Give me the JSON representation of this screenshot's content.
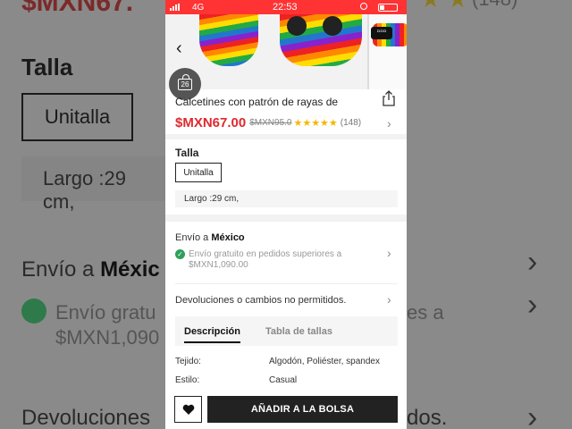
{
  "status_bar": {
    "network": "4G",
    "time": "22:53"
  },
  "background": {
    "price": "$MXN67.",
    "review_count": "(148)",
    "talla_label": "Talla",
    "size_option": "Unitalla",
    "largo": "Largo :29 cm,",
    "envio_prefix": "Envío a ",
    "envio_country": "Méxic",
    "gratis_line1": "Envío gratu",
    "gratis_line1_right": "es a",
    "gratis_line2": "$MXN1,090",
    "devoluciones": "Devoluciones",
    "devoluciones_right": "dos."
  },
  "cart": {
    "count": "26"
  },
  "gallery": {
    "thumb_indicator": "▫▫▫"
  },
  "product": {
    "title": "Calcetines con patrón de rayas de",
    "price": "$MXN67.00",
    "old_price": "$MXN95.0",
    "stars": "★★★★★",
    "rating": 4.5,
    "review_count": "(148)"
  },
  "size": {
    "label": "Talla",
    "option": "Unitalla",
    "largo": "Largo :29 cm,"
  },
  "shipping": {
    "prefix": "Envío a ",
    "country": "México",
    "free_text": "Envío gratuito en pedidos superiores a $MXN1,090.00"
  },
  "returns": {
    "text": "Devoluciones o cambios no permitidos."
  },
  "tabs": {
    "description": "Descripción",
    "size_chart": "Tabla de tallas"
  },
  "specs": [
    {
      "key": "Tejido:",
      "value": "Algodón, Poliéster, spandex"
    },
    {
      "key": "Estilo:",
      "value": "Casual"
    }
  ],
  "actions": {
    "add_to_bag": "AÑADIR A LA BOLSA"
  },
  "colors": {
    "brand_red": "#e0282e",
    "status_bar": "#ff3333",
    "star": "#f5b700",
    "check_green": "#2ca05a"
  }
}
